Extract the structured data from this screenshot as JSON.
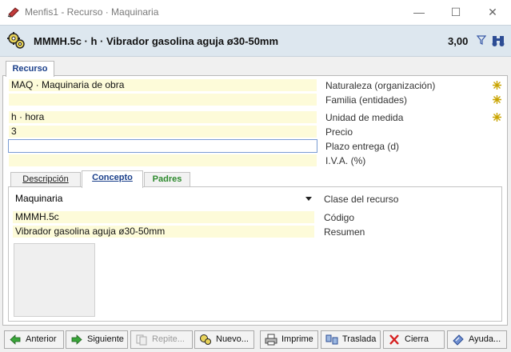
{
  "window": {
    "title": "Menfis1 - Recurso · Maquinaria",
    "minimize": "—",
    "maximize": "☐",
    "close": "✕"
  },
  "header": {
    "title": "MMMH.5c · h · Vibrador gasolina aguja ø30-50mm",
    "value": "3,00"
  },
  "main_tab": "Recurso",
  "fields": [
    {
      "value": "MAQ · Maquinaria de obra",
      "label": "Naturaleza (organización)"
    },
    {
      "value": "",
      "label": "Familia (entidades)"
    },
    {
      "value": "h · hora",
      "label": "Unidad de medida"
    },
    {
      "value": "3",
      "label": "Precio"
    },
    {
      "value": "",
      "label": "Plazo entrega (d)"
    },
    {
      "value": "",
      "label": "I.V.A. (%)"
    }
  ],
  "subtabs": [
    "Descripción",
    "Concepto",
    "Padres"
  ],
  "concept": {
    "clase_value": "Maquinaria",
    "clase_label": "Clase del recurso",
    "codigo_value": "MMMH.5c",
    "codigo_label": "Código",
    "resumen_value": "Vibrador gasolina aguja ø30-50mm",
    "resumen_label": "Resumen"
  },
  "buttons": [
    {
      "label": "Anterior",
      "icon": "arrow-left-icon"
    },
    {
      "label": "Siguiente",
      "icon": "arrow-right-icon"
    },
    {
      "label": "Repite...",
      "icon": "repeat-icon",
      "disabled": true
    },
    {
      "label": "Nuevo...",
      "icon": "new-icon"
    },
    {
      "label": "Imprime",
      "icon": "printer-icon"
    },
    {
      "label": "Traslada",
      "icon": "transfer-icon"
    },
    {
      "label": "Cierra",
      "icon": "close-x-icon"
    },
    {
      "label": "Ayuda...",
      "icon": "help-icon"
    }
  ],
  "colors": {
    "field_bg": "#fdfbd9",
    "header_bg": "#dde7ef",
    "accent": "#1a3f8a",
    "padres_tab": "#2d8a2d"
  }
}
